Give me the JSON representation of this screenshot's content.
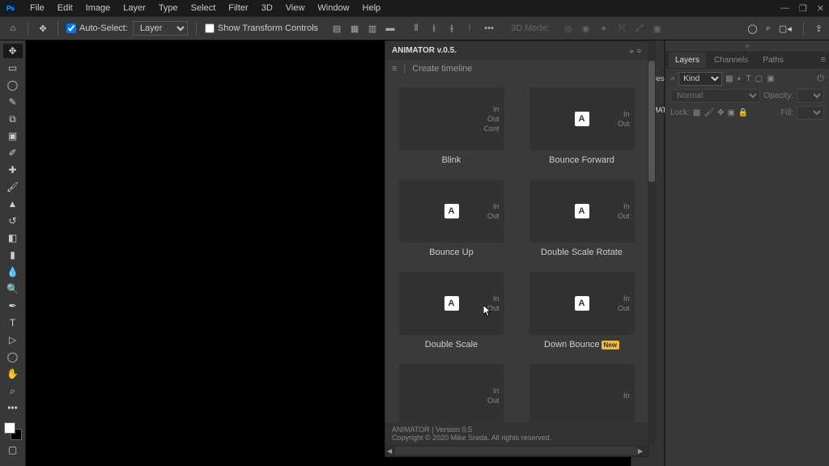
{
  "app": {
    "ps_logo": "Ps"
  },
  "menus": [
    "File",
    "Edit",
    "Image",
    "Layer",
    "Type",
    "Select",
    "Filter",
    "3D",
    "View",
    "Window",
    "Help"
  ],
  "options": {
    "auto_select": "Auto-Select:",
    "auto_select_value": "Layer",
    "show_transform": "Show Transform Controls",
    "mode3d": "3D Mode:"
  },
  "animator": {
    "title": "ANIMATOR v.0.5.",
    "create_timeline": "Create timeline",
    "footer_version": "ANIMATOR | Version 0.5",
    "footer_copyright": "Copyright © 2020 Mike Sreda. All rights reserved.",
    "presets": [
      {
        "label": "Blink",
        "io": [
          "In",
          "Out",
          "Cont"
        ],
        "show_a": false
      },
      {
        "label": "Bounce Forward",
        "io": [
          "In",
          "Out"
        ],
        "show_a": true
      },
      {
        "label": "Bounce Up",
        "io": [
          "In",
          "Out"
        ],
        "show_a": true
      },
      {
        "label": "Double Scale Rotate",
        "io": [
          "In",
          "Out"
        ],
        "show_a": true
      },
      {
        "label": "Double Scale",
        "io": [
          "In",
          "Out"
        ],
        "show_a": true
      },
      {
        "label": "Down Bounce",
        "io": [
          "In",
          "Out"
        ],
        "show_a": true,
        "badge": "New"
      },
      {
        "label": "",
        "io": [
          "In",
          "Out"
        ],
        "show_a": false
      },
      {
        "label": "",
        "io": [
          "In"
        ],
        "show_a": false
      }
    ]
  },
  "right": {
    "properties": "Properties",
    "animat_layer": "ANIMAT...",
    "tabs": [
      "Layers",
      "Channels",
      "Paths"
    ],
    "kind": "Kind",
    "blend": "Normal",
    "opacity": "Opacity:",
    "lock": "Lock:",
    "fill": "Fill:"
  }
}
